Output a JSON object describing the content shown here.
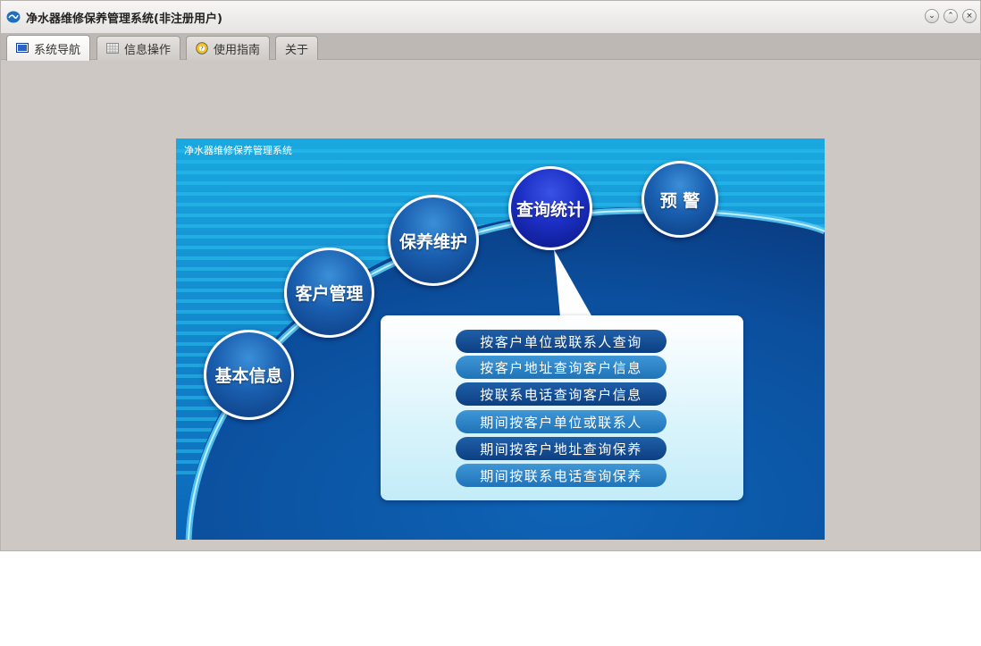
{
  "window": {
    "title": "净水器维修保养管理系统(非注册用户)",
    "controls": {
      "minimize": "⌄",
      "maximize": "⌃",
      "close": "×"
    }
  },
  "tabs": [
    {
      "label": "系统导航",
      "icon": "monitor-icon",
      "active": true
    },
    {
      "label": "信息操作",
      "icon": "grid-icon",
      "active": false
    },
    {
      "label": "使用指南",
      "icon": "help-icon",
      "active": false
    },
    {
      "label": "关于",
      "icon": "",
      "active": false
    }
  ],
  "panel": {
    "title": "净水器维修保养管理系统",
    "nodes": {
      "basic": "基本信息",
      "customer": "客户管理",
      "maintenance": "保养维护",
      "query": "查询统计",
      "warning": "预 警"
    },
    "menu": [
      "按客户单位或联系人查询",
      "按客户地址查询客户信息",
      "按联系电话查询客户信息",
      "期间按客户单位或联系人",
      "期间按客户地址查询保养",
      "期间按联系电话查询保养"
    ]
  },
  "colors": {
    "accent_blue": "#0b4c97",
    "node_active": "#1c2fc4",
    "window_bg": "#cdc8c4"
  }
}
